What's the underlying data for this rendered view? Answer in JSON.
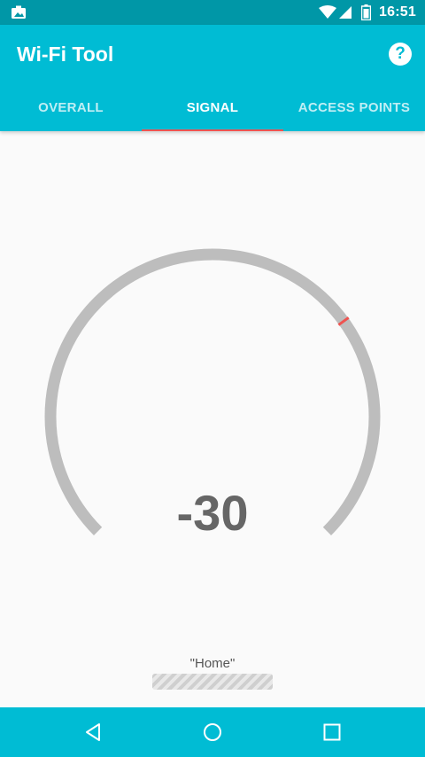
{
  "status_bar": {
    "time": "16:51",
    "icons": [
      "photo-notification-icon",
      "wifi-icon",
      "cell-signal-icon",
      "battery-icon"
    ]
  },
  "app": {
    "title": "Wi-Fi Tool",
    "help_icon": "help-icon",
    "help_label": "?"
  },
  "tabs": [
    {
      "label": "OVERALL",
      "active": false
    },
    {
      "label": "SIGNAL",
      "active": true
    },
    {
      "label": "ACCESS POINTS",
      "active": false
    }
  ],
  "signal": {
    "value": "-30",
    "gauge_level_dbm": -30,
    "gauge_indicator_color": "#ef5350",
    "gauge_track_color": "#bdbdbd"
  },
  "network": {
    "ssid": "\"Home\""
  },
  "nav": {
    "buttons": [
      "back-icon",
      "home-icon",
      "recents-icon"
    ]
  },
  "colors": {
    "primary": "#00bcd4",
    "primary_dark": "#0097a7",
    "accent": "#ef5350"
  }
}
